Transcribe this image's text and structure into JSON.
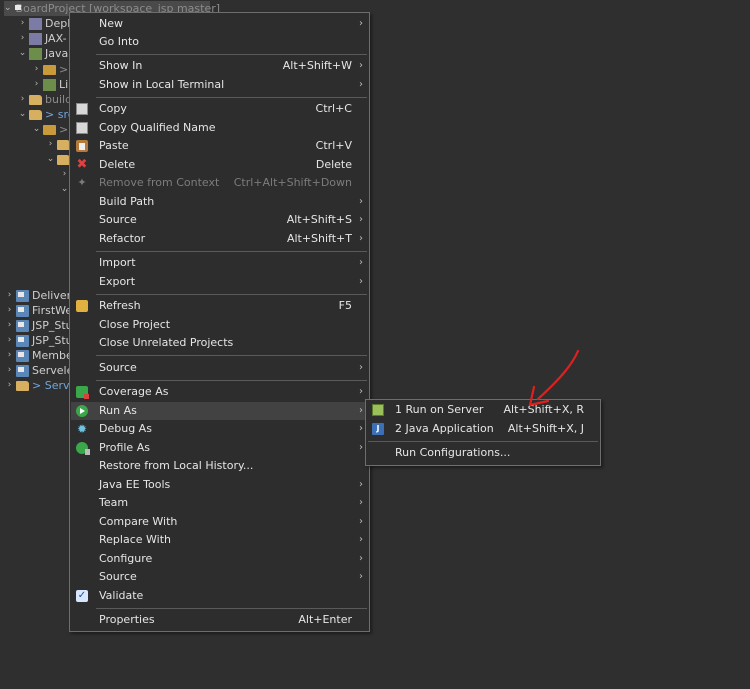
{
  "tree": {
    "root": {
      "label": "BoardProject [workspace_jsp master]",
      "prefix": ">"
    },
    "rows": [
      {
        "label": "Depl",
        "icon": "descriptor-icon"
      },
      {
        "label": "JAX-",
        "icon": "descriptor-icon"
      },
      {
        "label": "Java",
        "icon": "library-icon"
      },
      {
        "label": ">",
        "icon": "package-icon"
      },
      {
        "label": "Li",
        "icon": "library-icon"
      },
      {
        "label": "build",
        "icon": "folder-icon"
      },
      {
        "label": "> src",
        "icon": "folder-icon"
      },
      {
        "label": ">",
        "icon": "package-icon"
      },
      {
        "label": "",
        "icon": "folder-icon"
      },
      {
        "label": "",
        "icon": "folder-icon"
      },
      {
        "label": "",
        "icon": ""
      },
      {
        "label": "",
        "icon": ""
      }
    ],
    "projects": [
      {
        "label": "Delivery"
      },
      {
        "label": "FirstWel"
      },
      {
        "label": "JSP_Stu"
      },
      {
        "label": "JSP_Stu"
      },
      {
        "label": "Membe"
      },
      {
        "label": "Servelet"
      },
      {
        "label": "> Serve"
      }
    ]
  },
  "context_menu": {
    "items": [
      {
        "label": "New",
        "submenu": true
      },
      {
        "label": "Go Into"
      },
      {
        "label": "Show In",
        "shortcut": "Alt+Shift+W",
        "submenu": true
      },
      {
        "label": "Show in Local Terminal",
        "submenu": true
      },
      {
        "label": "Copy",
        "shortcut": "Ctrl+C",
        "icon": "copy-icon"
      },
      {
        "label": "Copy Qualified Name",
        "icon": "copy-qualified-icon"
      },
      {
        "label": "Paste",
        "shortcut": "Ctrl+V",
        "icon": "paste-icon"
      },
      {
        "label": "Delete",
        "shortcut": "Delete",
        "icon": "delete-icon"
      },
      {
        "label": "Remove from Context",
        "shortcut": "Ctrl+Alt+Shift+Down",
        "icon": "remove-context-icon",
        "disabled": true
      },
      {
        "label": "Build Path",
        "submenu": true
      },
      {
        "label": "Source",
        "shortcut": "Alt+Shift+S",
        "submenu": true
      },
      {
        "label": "Refactor",
        "shortcut": "Alt+Shift+T",
        "submenu": true
      },
      {
        "label": "Import",
        "submenu": true
      },
      {
        "label": "Export",
        "submenu": true
      },
      {
        "label": "Refresh",
        "shortcut": "F5",
        "icon": "refresh-icon"
      },
      {
        "label": "Close Project"
      },
      {
        "label": "Close Unrelated Projects"
      },
      {
        "label": "Source",
        "submenu": true
      },
      {
        "label": "Coverage As",
        "icon": "coverage-icon",
        "submenu": true
      },
      {
        "label": "Run As",
        "icon": "run-icon",
        "submenu": true,
        "active": true
      },
      {
        "label": "Debug As",
        "icon": "debug-icon",
        "submenu": true
      },
      {
        "label": "Profile As",
        "icon": "profile-icon",
        "submenu": true
      },
      {
        "label": "Restore from Local History..."
      },
      {
        "label": "Java EE Tools",
        "submenu": true
      },
      {
        "label": "Team",
        "submenu": true
      },
      {
        "label": "Compare With",
        "submenu": true
      },
      {
        "label": "Replace With",
        "submenu": true
      },
      {
        "label": "Configure",
        "submenu": true
      },
      {
        "label": "Source",
        "submenu": true
      },
      {
        "label": "Validate",
        "icon": "checkbox-icon"
      },
      {
        "label": "Properties",
        "shortcut": "Alt+Enter"
      }
    ]
  },
  "run_as_submenu": {
    "items": [
      {
        "label": "1 Run on Server",
        "shortcut": "Alt+Shift+X, R",
        "icon": "server-icon"
      },
      {
        "label": "2 Java Application",
        "shortcut": "Alt+Shift+X, J",
        "icon": "java-app-icon"
      },
      {
        "label": "Run Configurations..."
      }
    ]
  },
  "annotation": {
    "color": "#e02020"
  },
  "glyphs": {
    "arrow": "›",
    "chevron_right": "›",
    "chevron_down": "⌄"
  }
}
